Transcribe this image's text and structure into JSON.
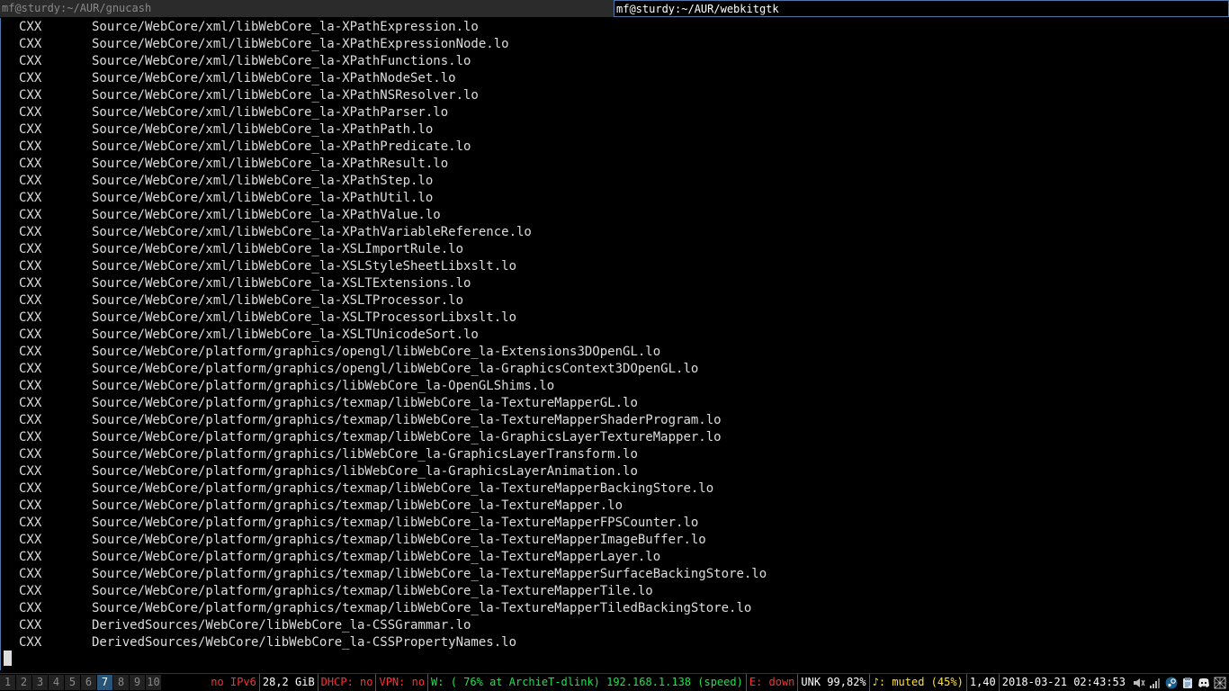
{
  "tabs": [
    {
      "title": "mf@sturdy:~/AUR/gnucash",
      "active": false
    },
    {
      "title": "mf@sturdy:~/AUR/webkitgtk",
      "active": true
    }
  ],
  "terminal": {
    "lines": [
      {
        "cmd": "CXX",
        "path": "Source/WebCore/xml/libWebCore_la-XPathExpression.lo"
      },
      {
        "cmd": "CXX",
        "path": "Source/WebCore/xml/libWebCore_la-XPathExpressionNode.lo"
      },
      {
        "cmd": "CXX",
        "path": "Source/WebCore/xml/libWebCore_la-XPathFunctions.lo"
      },
      {
        "cmd": "CXX",
        "path": "Source/WebCore/xml/libWebCore_la-XPathNodeSet.lo"
      },
      {
        "cmd": "CXX",
        "path": "Source/WebCore/xml/libWebCore_la-XPathNSResolver.lo"
      },
      {
        "cmd": "CXX",
        "path": "Source/WebCore/xml/libWebCore_la-XPathParser.lo"
      },
      {
        "cmd": "CXX",
        "path": "Source/WebCore/xml/libWebCore_la-XPathPath.lo"
      },
      {
        "cmd": "CXX",
        "path": "Source/WebCore/xml/libWebCore_la-XPathPredicate.lo"
      },
      {
        "cmd": "CXX",
        "path": "Source/WebCore/xml/libWebCore_la-XPathResult.lo"
      },
      {
        "cmd": "CXX",
        "path": "Source/WebCore/xml/libWebCore_la-XPathStep.lo"
      },
      {
        "cmd": "CXX",
        "path": "Source/WebCore/xml/libWebCore_la-XPathUtil.lo"
      },
      {
        "cmd": "CXX",
        "path": "Source/WebCore/xml/libWebCore_la-XPathValue.lo"
      },
      {
        "cmd": "CXX",
        "path": "Source/WebCore/xml/libWebCore_la-XPathVariableReference.lo"
      },
      {
        "cmd": "CXX",
        "path": "Source/WebCore/xml/libWebCore_la-XSLImportRule.lo"
      },
      {
        "cmd": "CXX",
        "path": "Source/WebCore/xml/libWebCore_la-XSLStyleSheetLibxslt.lo"
      },
      {
        "cmd": "CXX",
        "path": "Source/WebCore/xml/libWebCore_la-XSLTExtensions.lo"
      },
      {
        "cmd": "CXX",
        "path": "Source/WebCore/xml/libWebCore_la-XSLTProcessor.lo"
      },
      {
        "cmd": "CXX",
        "path": "Source/WebCore/xml/libWebCore_la-XSLTProcessorLibxslt.lo"
      },
      {
        "cmd": "CXX",
        "path": "Source/WebCore/xml/libWebCore_la-XSLTUnicodeSort.lo"
      },
      {
        "cmd": "CXX",
        "path": "Source/WebCore/platform/graphics/opengl/libWebCore_la-Extensions3DOpenGL.lo"
      },
      {
        "cmd": "CXX",
        "path": "Source/WebCore/platform/graphics/opengl/libWebCore_la-GraphicsContext3DOpenGL.lo"
      },
      {
        "cmd": "CXX",
        "path": "Source/WebCore/platform/graphics/libWebCore_la-OpenGLShims.lo"
      },
      {
        "cmd": "CXX",
        "path": "Source/WebCore/platform/graphics/texmap/libWebCore_la-TextureMapperGL.lo"
      },
      {
        "cmd": "CXX",
        "path": "Source/WebCore/platform/graphics/texmap/libWebCore_la-TextureMapperShaderProgram.lo"
      },
      {
        "cmd": "CXX",
        "path": "Source/WebCore/platform/graphics/texmap/libWebCore_la-GraphicsLayerTextureMapper.lo"
      },
      {
        "cmd": "CXX",
        "path": "Source/WebCore/platform/graphics/libWebCore_la-GraphicsLayerTransform.lo"
      },
      {
        "cmd": "CXX",
        "path": "Source/WebCore/platform/graphics/libWebCore_la-GraphicsLayerAnimation.lo"
      },
      {
        "cmd": "CXX",
        "path": "Source/WebCore/platform/graphics/texmap/libWebCore_la-TextureMapperBackingStore.lo"
      },
      {
        "cmd": "CXX",
        "path": "Source/WebCore/platform/graphics/texmap/libWebCore_la-TextureMapper.lo"
      },
      {
        "cmd": "CXX",
        "path": "Source/WebCore/platform/graphics/texmap/libWebCore_la-TextureMapperFPSCounter.lo"
      },
      {
        "cmd": "CXX",
        "path": "Source/WebCore/platform/graphics/texmap/libWebCore_la-TextureMapperImageBuffer.lo"
      },
      {
        "cmd": "CXX",
        "path": "Source/WebCore/platform/graphics/texmap/libWebCore_la-TextureMapperLayer.lo"
      },
      {
        "cmd": "CXX",
        "path": "Source/WebCore/platform/graphics/texmap/libWebCore_la-TextureMapperSurfaceBackingStore.lo"
      },
      {
        "cmd": "CXX",
        "path": "Source/WebCore/platform/graphics/texmap/libWebCore_la-TextureMapperTile.lo"
      },
      {
        "cmd": "CXX",
        "path": "Source/WebCore/platform/graphics/texmap/libWebCore_la-TextureMapperTiledBackingStore.lo"
      },
      {
        "cmd": "CXX",
        "path": "DerivedSources/WebCore/libWebCore_la-CSSGrammar.lo"
      },
      {
        "cmd": "CXX",
        "path": "DerivedSources/WebCore/libWebCore_la-CSSPropertyNames.lo"
      }
    ]
  },
  "statusbar": {
    "workspaces": [
      "1",
      "2",
      "3",
      "4",
      "5",
      "6",
      "7",
      "8",
      "9",
      "10"
    ],
    "active_workspace": "7",
    "items": [
      {
        "text": "no IPv6",
        "color": "red"
      },
      {
        "text": "28,2 GiB",
        "color": "white"
      },
      {
        "text": "DHCP: no",
        "color": "red"
      },
      {
        "text": "VPN: no",
        "color": "red"
      },
      {
        "text": "W: ( 76% at ArchieT-dlink) 192.168.1.138 (speed)",
        "color": "green"
      },
      {
        "text": "E: down",
        "color": "red"
      },
      {
        "text": "UNK 99,82%",
        "color": "white"
      },
      {
        "text": "♪: muted (45%)",
        "color": "yellow"
      },
      {
        "text": "1,40",
        "color": "white"
      },
      {
        "text": "2018-03-21 02:43:53",
        "color": "white"
      }
    ],
    "tray": [
      "speaker-icon",
      "network-signal-icon",
      "steam-icon",
      "clipboard-icon",
      "discord-icon",
      "keyboard-icon"
    ]
  },
  "colors": {
    "background": "#000000",
    "text": "#dddddd",
    "active_border": "#4a78a8",
    "active_workspace": "#285577",
    "red": "#ff3030",
    "green": "#20e050",
    "yellow": "#ffe030"
  }
}
